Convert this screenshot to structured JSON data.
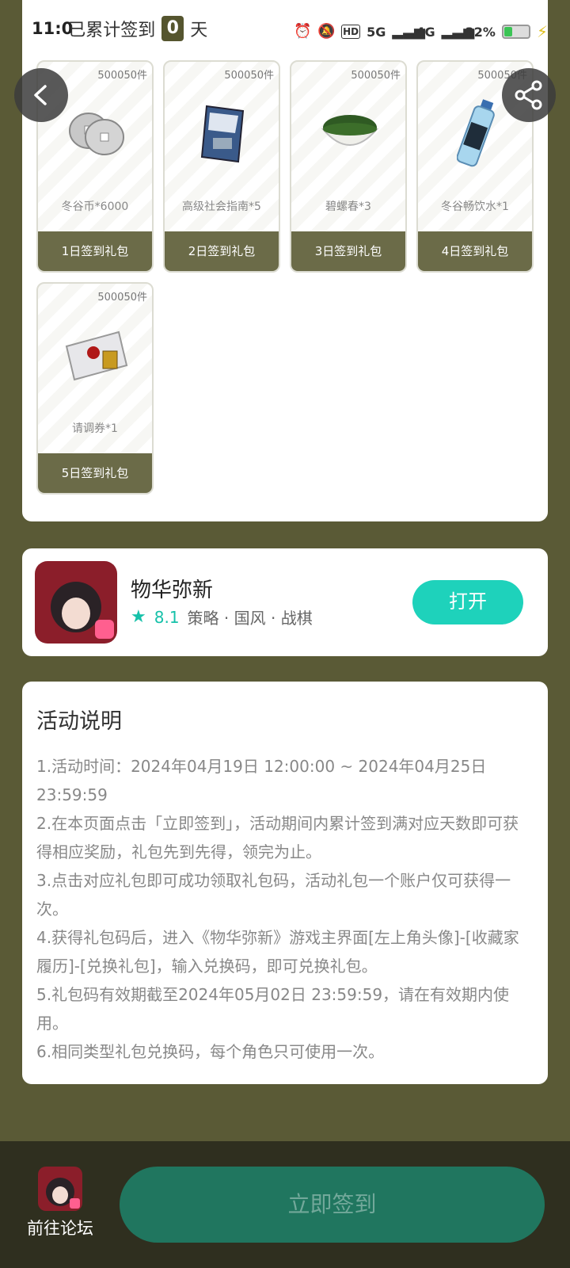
{
  "status_bar": {
    "time": "11:0",
    "network_5g": "5G",
    "network_4g": "4G",
    "battery": "32%"
  },
  "header": {
    "streak_label": "已累计签到",
    "streak_count": "0",
    "streak_unit": "天"
  },
  "gifts": [
    {
      "stock": "500050件",
      "name": "冬谷币*6000",
      "label": "1日签到礼包",
      "icon": "coins-icon"
    },
    {
      "stock": "500050件",
      "name": "高级社会指南*5",
      "label": "2日签到礼包",
      "icon": "book-icon"
    },
    {
      "stock": "500050件",
      "name": "碧螺春*3",
      "label": "3日签到礼包",
      "icon": "tea-bowl-icon"
    },
    {
      "stock": "500050件",
      "name": "冬谷畅饮水*1",
      "label": "4日签到礼包",
      "icon": "water-bottle-icon"
    },
    {
      "stock": "500050件",
      "name": "请调券*1",
      "label": "5日签到礼包",
      "icon": "envelope-icon"
    }
  ],
  "app": {
    "name": "物华弥新",
    "rating": "8.1",
    "tags": "策略 · 国风 · 战棋",
    "open_label": "打开"
  },
  "rules": {
    "title": "活动说明",
    "items": [
      "1.活动时间：2024年04月19日 12:00:00 ~ 2024年04月25日 23:59:59",
      "2.在本页面点击「立即签到」，活动期间内累计签到满对应天数即可获得相应奖励，礼包先到先得，领完为止。",
      "3.点击对应礼包即可成功领取礼包码，活动礼包一个账户仅可获得一次。",
      "4.获得礼包码后，进入《物华弥新》游戏主界面[左上角头像]-[收藏家履历]-[兑换礼包]，输入兑换码，即可兑换礼包。",
      "5.礼包码有效期截至2024年05月02日 23:59:59，请在有效期内使用。",
      "6.相同类型礼包兑换码，每个角色只可使用一次。"
    ]
  },
  "bottom": {
    "forum_label": "前往论坛",
    "signin_label": "立即签到"
  }
}
